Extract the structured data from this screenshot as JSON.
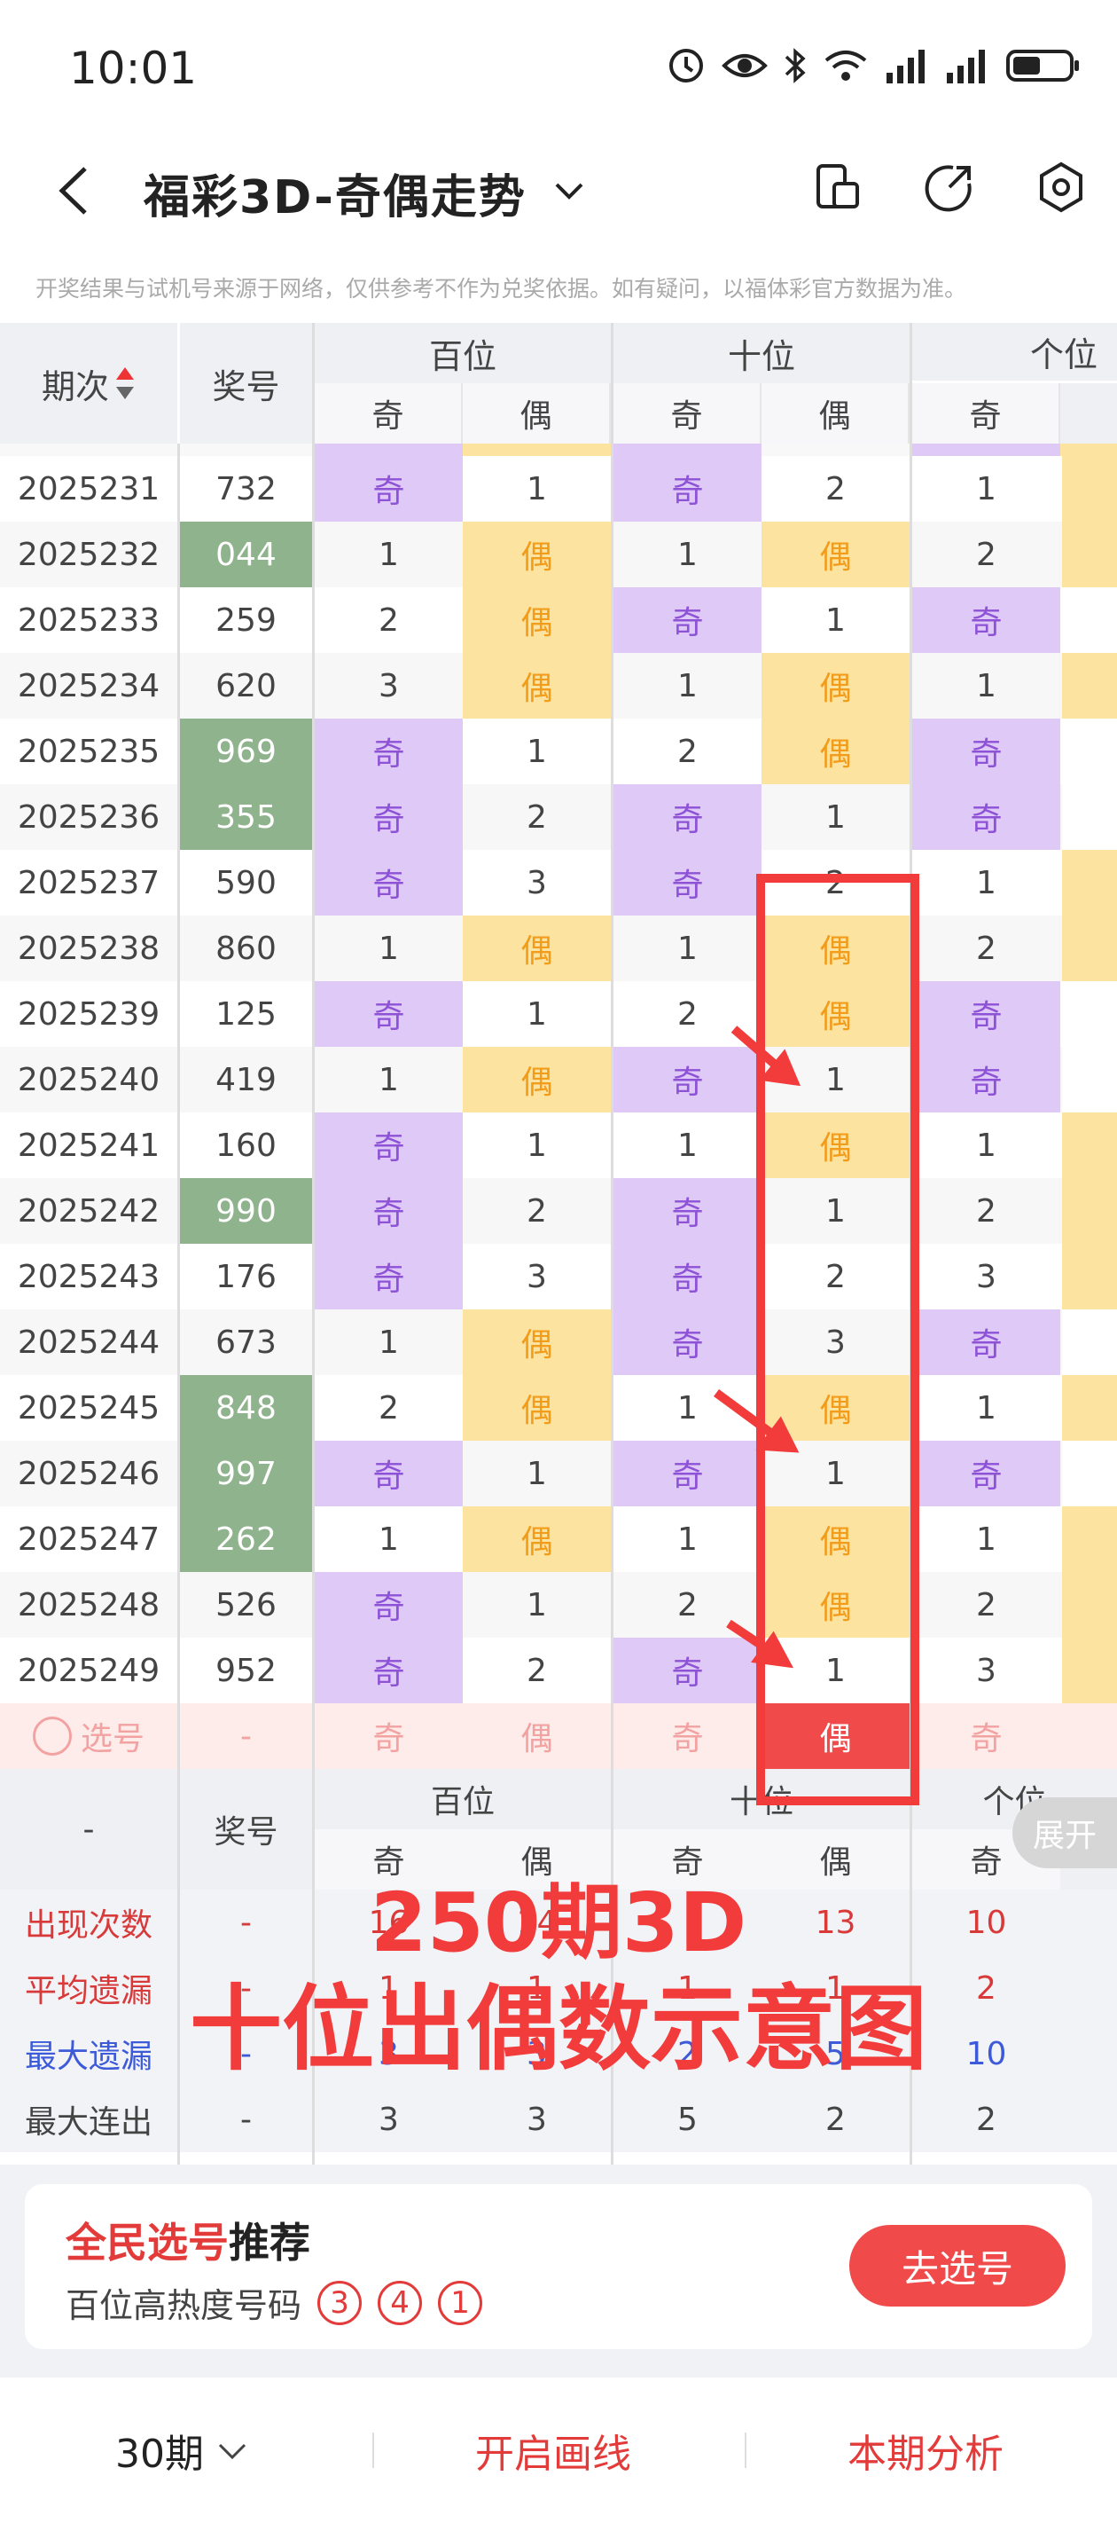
{
  "status_bar": {
    "time": "10:01"
  },
  "header": {
    "title": "福彩3D-奇偶走势"
  },
  "notice": "开奖结果与试机号来源于网络，仅供参考不作为兑奖依据。如有疑问，以福体彩官方数据为准。",
  "table": {
    "col_period": "期次",
    "col_number": "奖号",
    "groups": [
      "百位",
      "十位",
      "个位"
    ],
    "sub_odd": "奇",
    "sub_even": "偶",
    "rows": [
      {
        "period": "2025231",
        "num": "732",
        "num_hl": false,
        "b": [
          "奇",
          "1"
        ],
        "s": [
          "奇",
          "2"
        ],
        "g": "1"
      },
      {
        "period": "2025232",
        "num": "044",
        "num_hl": true,
        "b": [
          "1",
          "偶"
        ],
        "s": [
          "1",
          "偶"
        ],
        "g": "2"
      },
      {
        "period": "2025233",
        "num": "259",
        "num_hl": false,
        "b": [
          "2",
          "偶"
        ],
        "s": [
          "奇",
          "1"
        ],
        "g": "奇"
      },
      {
        "period": "2025234",
        "num": "620",
        "num_hl": false,
        "b": [
          "3",
          "偶"
        ],
        "s": [
          "1",
          "偶"
        ],
        "g": "1"
      },
      {
        "period": "2025235",
        "num": "969",
        "num_hl": true,
        "b": [
          "奇",
          "1"
        ],
        "s": [
          "2",
          "偶"
        ],
        "g": "奇"
      },
      {
        "period": "2025236",
        "num": "355",
        "num_hl": true,
        "b": [
          "奇",
          "2"
        ],
        "s": [
          "奇",
          "1"
        ],
        "g": "奇"
      },
      {
        "period": "2025237",
        "num": "590",
        "num_hl": false,
        "b": [
          "奇",
          "3"
        ],
        "s": [
          "奇",
          "2"
        ],
        "g": "1"
      },
      {
        "period": "2025238",
        "num": "860",
        "num_hl": false,
        "b": [
          "1",
          "偶"
        ],
        "s": [
          "1",
          "偶"
        ],
        "g": "2"
      },
      {
        "period": "2025239",
        "num": "125",
        "num_hl": false,
        "b": [
          "奇",
          "1"
        ],
        "s": [
          "2",
          "偶"
        ],
        "g": "奇"
      },
      {
        "period": "2025240",
        "num": "419",
        "num_hl": false,
        "b": [
          "1",
          "偶"
        ],
        "s": [
          "奇",
          "1"
        ],
        "g": "奇"
      },
      {
        "period": "2025241",
        "num": "160",
        "num_hl": false,
        "b": [
          "奇",
          "1"
        ],
        "s": [
          "1",
          "偶"
        ],
        "g": "1"
      },
      {
        "period": "2025242",
        "num": "990",
        "num_hl": true,
        "b": [
          "奇",
          "2"
        ],
        "s": [
          "奇",
          "1"
        ],
        "g": "2"
      },
      {
        "period": "2025243",
        "num": "176",
        "num_hl": false,
        "b": [
          "奇",
          "3"
        ],
        "s": [
          "奇",
          "2"
        ],
        "g": "3"
      },
      {
        "period": "2025244",
        "num": "673",
        "num_hl": false,
        "b": [
          "1",
          "偶"
        ],
        "s": [
          "奇",
          "3"
        ],
        "g": "奇"
      },
      {
        "period": "2025245",
        "num": "848",
        "num_hl": true,
        "b": [
          "2",
          "偶"
        ],
        "s": [
          "1",
          "偶"
        ],
        "g": "1"
      },
      {
        "period": "2025246",
        "num": "997",
        "num_hl": true,
        "b": [
          "奇",
          "1"
        ],
        "s": [
          "奇",
          "1"
        ],
        "g": "奇"
      },
      {
        "period": "2025247",
        "num": "262",
        "num_hl": true,
        "b": [
          "1",
          "偶"
        ],
        "s": [
          "1",
          "偶"
        ],
        "g": "1"
      },
      {
        "period": "2025248",
        "num": "526",
        "num_hl": false,
        "b": [
          "奇",
          "1"
        ],
        "s": [
          "2",
          "偶"
        ],
        "g": "2"
      },
      {
        "period": "2025249",
        "num": "952",
        "num_hl": false,
        "b": [
          "奇",
          "2"
        ],
        "s": [
          "奇",
          "1"
        ],
        "g": "3"
      }
    ],
    "select_row": {
      "label": "选号",
      "num": "-",
      "cells": [
        "奇",
        "偶",
        "奇",
        "偶",
        "奇"
      ]
    },
    "expand_label": "展开",
    "stats": {
      "dash": "-",
      "rows": [
        {
          "label": "出现次数",
          "color": "#d83a3a",
          "num": "-",
          "vals": [
            "16",
            "14",
            "",
            "13",
            "10"
          ]
        },
        {
          "label": "平均遗漏",
          "color": "#d83a3a",
          "num": "-",
          "vals": [
            "1",
            "1",
            "1",
            "1",
            "2"
          ]
        },
        {
          "label": "最大遗漏",
          "color": "#3d5bd8",
          "num": "-",
          "vals": [
            "3",
            "3",
            "2",
            "5",
            "10"
          ]
        },
        {
          "label": "最大连出",
          "color": "#444444",
          "num": "-",
          "vals": [
            "3",
            "3",
            "5",
            "2",
            "2"
          ]
        }
      ]
    }
  },
  "overlay": {
    "line1": "250期3D",
    "line2": "十位出偶数示意图"
  },
  "recommend": {
    "title_red": "全民选号",
    "title_black": "推荐",
    "subtitle": "百位高热度号码",
    "numbers": [
      "3",
      "4",
      "1"
    ],
    "button": "去选号"
  },
  "tabbar": {
    "periods": "30期",
    "draw_lines": "开启画线",
    "analysis": "本期分析"
  },
  "colors": {
    "accent": "#f04a4a",
    "odd_bg": "#dfcaf7",
    "even_bg": "#fde3a0",
    "hl_num": "#8fb38c"
  }
}
